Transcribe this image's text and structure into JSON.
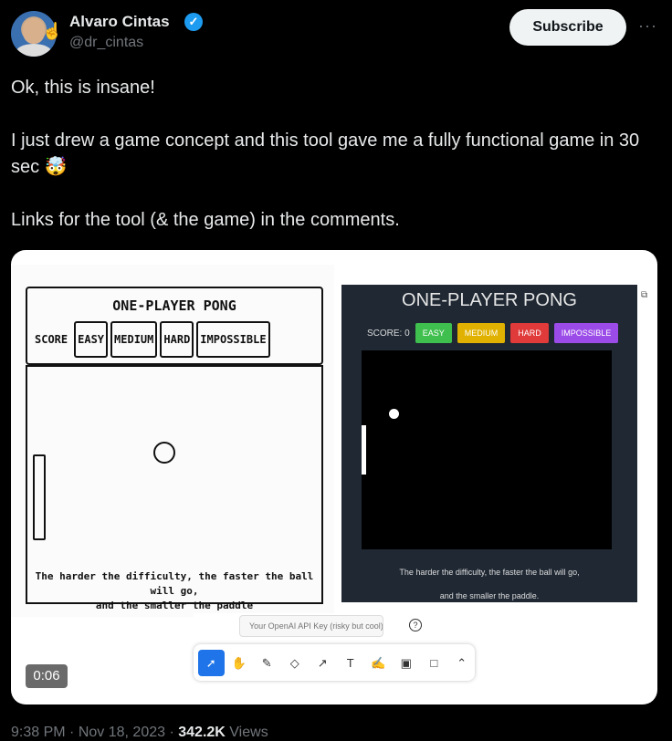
{
  "author": {
    "name": "Alvaro Cintas",
    "handle": "@dr_cintas",
    "verified_icon": "check-badge-icon",
    "verified_glyph": "✓"
  },
  "subscribe_label": "Subscribe",
  "more_glyph": "···",
  "tweet": {
    "line1": "Ok, this is insane!",
    "line2": "I just drew a game concept and this tool gave me a fully functional game in 30 sec 🤯",
    "line3": "Links for the tool (& the game) in the comments."
  },
  "sketch": {
    "title": "ONE-PLAYER PONG",
    "score": "SCORE",
    "buttons": [
      "EASY",
      "MEDIUM",
      "HARD",
      "IMPOSSIBLE"
    ],
    "caption1": "The harder the difficulty, the faster the ball will go,",
    "caption2": "and the smaller the paddle"
  },
  "game": {
    "title": "ONE-PLAYER PONG",
    "score": "SCORE: 0",
    "buttons": [
      {
        "label": "EASY",
        "color": "#3fbf4e"
      },
      {
        "label": "MEDIUM",
        "color": "#e0b100"
      },
      {
        "label": "HARD",
        "color": "#e03a3a"
      },
      {
        "label": "IMPOSSIBLE",
        "color": "#9b4be8"
      }
    ],
    "caption1": "The harder the difficulty, the faster the ball will go,",
    "caption2": "and the smaller the paddle."
  },
  "api_key_placeholder": "Your OpenAI API Key (risky but cool)",
  "help_glyph": "?",
  "tools": [
    {
      "name": "select-icon",
      "glyph": "➚"
    },
    {
      "name": "hand-icon",
      "glyph": "✋"
    },
    {
      "name": "pencil-icon",
      "glyph": "✎"
    },
    {
      "name": "eraser-icon",
      "glyph": "◇"
    },
    {
      "name": "arrow-icon",
      "glyph": "↗"
    },
    {
      "name": "text-icon",
      "glyph": "T"
    },
    {
      "name": "note-icon",
      "glyph": "✍"
    },
    {
      "name": "image-icon",
      "glyph": "▣"
    },
    {
      "name": "rectangle-icon",
      "glyph": "□"
    },
    {
      "name": "chevron-up-icon",
      "glyph": "⌃"
    }
  ],
  "video_time": "0:06",
  "meta": {
    "time": "9:38 PM",
    "date": "Nov 18, 2023",
    "views_count": "342.2K",
    "views_label": "Views"
  }
}
